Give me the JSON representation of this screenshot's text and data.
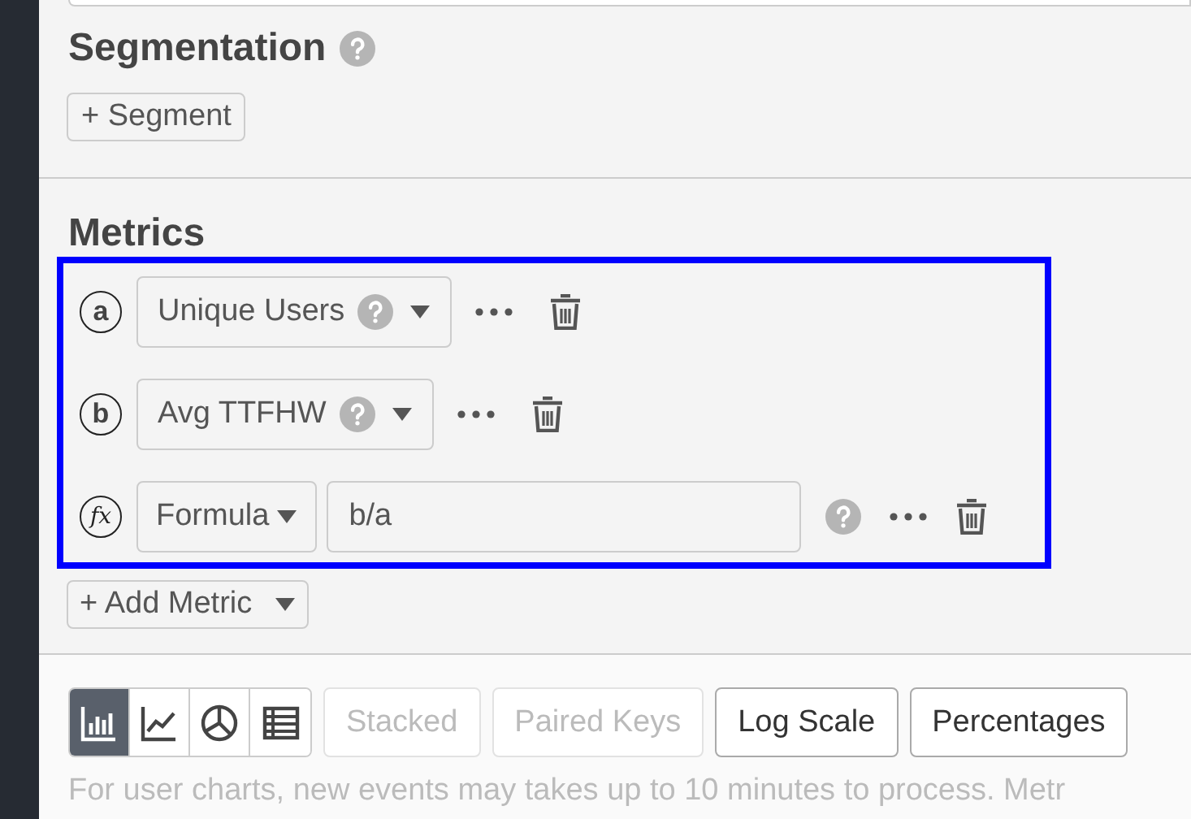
{
  "segmentation": {
    "heading": "Segmentation",
    "add_button": "+ Segment"
  },
  "metrics": {
    "heading": "Metrics",
    "highlighted": true,
    "items": [
      {
        "kind": "event",
        "letter": "a",
        "name": "Unique Users"
      },
      {
        "kind": "event",
        "letter": "b",
        "name": "Avg TTFHW"
      },
      {
        "kind": "formula",
        "letter": "fx",
        "label": "Formula",
        "value": "b/a"
      }
    ],
    "add_button": "+ Add Metric"
  },
  "chart_types": [
    {
      "kind": "bar",
      "selected": true
    },
    {
      "kind": "line",
      "selected": false
    },
    {
      "kind": "pie",
      "selected": false
    },
    {
      "kind": "table",
      "selected": false
    }
  ],
  "options": [
    {
      "label": "Stacked",
      "disabled": true
    },
    {
      "label": "Paired Keys",
      "disabled": true
    },
    {
      "label": "Log Scale",
      "disabled": false
    },
    {
      "label": "Percentages",
      "disabled": false
    }
  ],
  "note": "For user charts, new events may takes up to 10 minutes to process. Metr"
}
